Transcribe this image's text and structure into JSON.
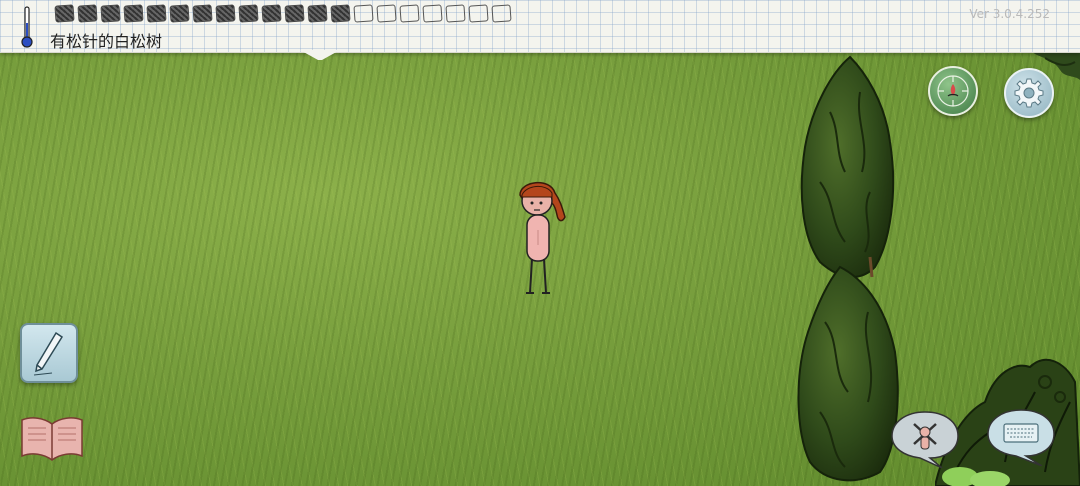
{
  "hud": {
    "location_text": "有松针的白松树",
    "version": "Ver 3.0.4.252",
    "thermometer_icon": "thermometer-icon",
    "inventory_slots_filled": 13,
    "inventory_slots_total": 20
  },
  "buttons": {
    "compass": "compass-icon",
    "settings": "gear-icon",
    "journal": "pencil-icon",
    "book": "book-icon",
    "craft": "character-craft-icon",
    "keyboard": "keyboard-icon"
  },
  "colors": {
    "grass": "#769d3c",
    "paper": "#f4f4ee",
    "compass": "#3f7a44",
    "settings": "#8fb2bf"
  }
}
